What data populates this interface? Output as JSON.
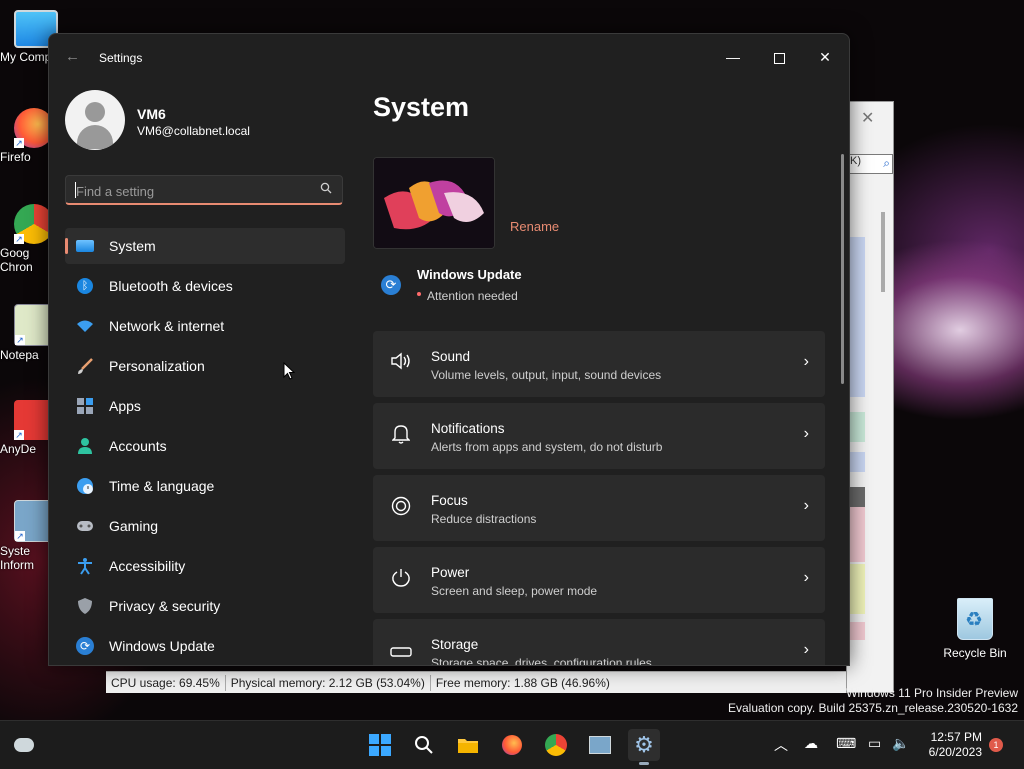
{
  "desktop": {
    "icons": [
      {
        "label": "My Comp"
      },
      {
        "label": "Firefo"
      },
      {
        "label": "Goog Chron"
      },
      {
        "label": "Notepa"
      },
      {
        "label": "AnyDe"
      },
      {
        "label": "Syste Inform"
      }
    ],
    "recycle_bin": "Recycle Bin",
    "watermark": {
      "line1": "Windows 11 Pro Insider Preview",
      "line2": "Evaluation copy. Build 25375.zn_release.230520-1632"
    }
  },
  "background_window": {
    "search_text": "K)",
    "status": {
      "cpu": "CPU usage: 69.45%",
      "physical": "Physical memory: 2.12 GB (53.04%)",
      "free": "Free memory: 1.88 GB (46.96%)"
    }
  },
  "settings": {
    "window_title": "Settings",
    "user": {
      "name": "VM6",
      "email": "VM6@collabnet.local"
    },
    "search": {
      "placeholder": "Find a setting"
    },
    "nav": [
      {
        "label": "System",
        "icon": "system-display-icon",
        "active": true
      },
      {
        "label": "Bluetooth & devices",
        "icon": "bluetooth-icon"
      },
      {
        "label": "Network & internet",
        "icon": "wifi-icon"
      },
      {
        "label": "Personalization",
        "icon": "paintbrush-icon"
      },
      {
        "label": "Apps",
        "icon": "apps-icon"
      },
      {
        "label": "Accounts",
        "icon": "person-icon"
      },
      {
        "label": "Time & language",
        "icon": "globe-clock-icon"
      },
      {
        "label": "Gaming",
        "icon": "gamepad-icon"
      },
      {
        "label": "Accessibility",
        "icon": "accessibility-icon"
      },
      {
        "label": "Privacy & security",
        "icon": "shield-icon"
      },
      {
        "label": "Windows Update",
        "icon": "update-icon"
      }
    ],
    "page": {
      "title": "System",
      "rename": "Rename",
      "windows_update": {
        "title": "Windows Update",
        "status": "Attention needed"
      },
      "cards": [
        {
          "title": "Sound",
          "subtitle": "Volume levels, output, input, sound devices",
          "icon": "speaker-icon"
        },
        {
          "title": "Notifications",
          "subtitle": "Alerts from apps and system, do not disturb",
          "icon": "bell-icon"
        },
        {
          "title": "Focus",
          "subtitle": "Reduce distractions",
          "icon": "focus-icon"
        },
        {
          "title": "Power",
          "subtitle": "Screen and sleep, power mode",
          "icon": "power-icon"
        },
        {
          "title": "Storage",
          "subtitle": "Storage space, drives, configuration rules",
          "icon": "storage-icon"
        }
      ]
    }
  },
  "taskbar": {
    "time": "12:57 PM",
    "date": "6/20/2023",
    "notification_count": "1"
  },
  "colors": {
    "accent": "#e88b72",
    "window_bg": "#202020",
    "card_bg": "#2b2b2b"
  }
}
